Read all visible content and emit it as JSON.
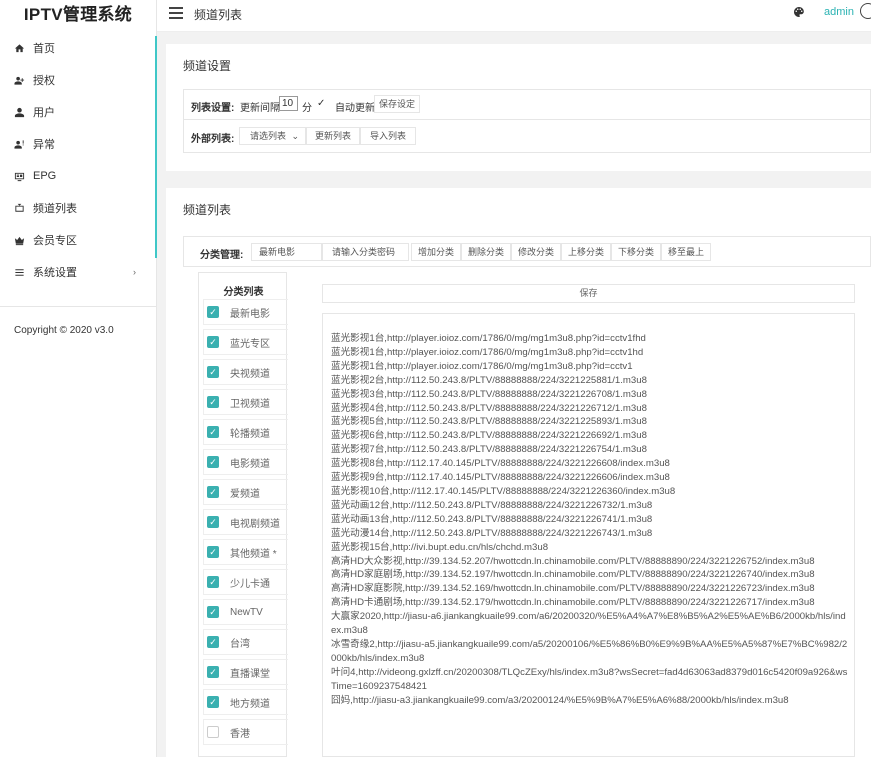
{
  "app": {
    "logo": "IPTV管理系统",
    "copyright": "Copyright © 2020 v3.0"
  },
  "sidebar": {
    "items": [
      {
        "label": "首页",
        "icon": "home-icon"
      },
      {
        "label": "授权",
        "icon": "user-plus-icon"
      },
      {
        "label": "用户",
        "icon": "user-icon"
      },
      {
        "label": "异常",
        "icon": "user-alert-icon"
      },
      {
        "label": "EPG",
        "icon": "tv-guide-icon"
      },
      {
        "label": "频道列表",
        "icon": "tv-icon"
      },
      {
        "label": "会员专区",
        "icon": "crown-icon"
      },
      {
        "label": "系统设置",
        "icon": "list-icon",
        "arrow": "›"
      }
    ]
  },
  "header": {
    "title": "频道列表",
    "user": "admin"
  },
  "settings": {
    "title": "频道设置",
    "list_settings_label": "列表设置:",
    "interval_label": "更新间隔",
    "interval_value": "10",
    "interval_unit": "分",
    "auto_update_check": "✓",
    "auto_update_label": "自动更新",
    "save_settings": "保存设定",
    "external_label": "外部列表:",
    "select_list": "请选列表",
    "update_list": "更新列表",
    "import_list": "导入列表"
  },
  "channels": {
    "title": "频道列表",
    "category_mgmt_label": "分类管理:",
    "category_name": "最新电影",
    "password_placeholder": "请输入分类密码",
    "buttons": [
      "增加分类",
      "删除分类",
      "修改分类",
      "上移分类",
      "下移分类",
      "移至最上"
    ],
    "category_list_title": "分类列表",
    "save": "保存",
    "categories": [
      {
        "label": "最新电影",
        "checked": true
      },
      {
        "label": "蓝光专区",
        "checked": true
      },
      {
        "label": "央视频道",
        "checked": true
      },
      {
        "label": "卫视频道",
        "checked": true
      },
      {
        "label": "轮播频道",
        "checked": true
      },
      {
        "label": "电影频道",
        "checked": true
      },
      {
        "label": "爱频道",
        "checked": true
      },
      {
        "label": "电视剧频道",
        "checked": true
      },
      {
        "label": "其他频道 *",
        "checked": true
      },
      {
        "label": "少儿卡通",
        "checked": true
      },
      {
        "label": "NewTV",
        "checked": true
      },
      {
        "label": "台湾",
        "checked": true
      },
      {
        "label": "直播课堂",
        "checked": true
      },
      {
        "label": "地方频道",
        "checked": true
      },
      {
        "label": "香港",
        "checked": false
      }
    ],
    "list_text": "蓝光影视1台,http://player.ioioz.com/1786/0/mg/mg1m3u8.php?id=cctv1fhd\n蓝光影视1台,http://player.ioioz.com/1786/0/mg/mg1m3u8.php?id=cctv1hd\n蓝光影视1台,http://player.ioioz.com/1786/0/mg/mg1m3u8.php?id=cctv1\n蓝光影视2台,http://112.50.243.8/PLTV/88888888/224/3221225881/1.m3u8\n蓝光影视3台,http://112.50.243.8/PLTV/88888888/224/3221226708/1.m3u8\n蓝光影视4台,http://112.50.243.8/PLTV/88888888/224/3221226712/1.m3u8\n蓝光影视5台,http://112.50.243.8/PLTV/88888888/224/3221225893/1.m3u8\n蓝光影视6台,http://112.50.243.8/PLTV/88888888/224/3221226692/1.m3u8\n蓝光影视7台,http://112.50.243.8/PLTV/88888888/224/3221226754/1.m3u8\n蓝光影视8台,http://112.17.40.145/PLTV/88888888/224/3221226608/index.m3u8\n蓝光影视9台,http://112.17.40.145/PLTV/88888888/224/3221226606/index.m3u8\n蓝光影视10台,http://112.17.40.145/PLTV/88888888/224/3221226360/index.m3u8\n蓝光动画12台,http://112.50.243.8/PLTV/88888888/224/3221226732/1.m3u8\n蓝光动画13台,http://112.50.243.8/PLTV/88888888/224/3221226741/1.m3u8\n蓝光动漫14台,http://112.50.243.8/PLTV/88888888/224/3221226743/1.m3u8\n蓝光影视15台,http://ivi.bupt.edu.cn/hls/chchd.m3u8\n高清HD大众影视,http://39.134.52.207/hwottcdn.ln.chinamobile.com/PLTV/88888890/224/3221226752/index.m3u8\n高清HD家庭剧场,http://39.134.52.197/hwottcdn.ln.chinamobile.com/PLTV/88888890/224/3221226740/index.m3u8\n高清HD家庭影院,http://39.134.52.169/hwottcdn.ln.chinamobile.com/PLTV/88888890/224/3221226723/index.m3u8\n高清HD卡通剧场,http://39.134.52.179/hwottcdn.ln.chinamobile.com/PLTV/88888890/224/3221226717/index.m3u8\n大赢家2020,http://jiasu-a6.jiankangkuaile99.com/a6/20200320/%E5%A4%A7%E8%B5%A2%E5%AE%B6/2000kb/hls/index.m3u8\n冰雪奇缘2,http://jiasu-a5.jiankangkuaile99.com/a5/20200106/%E5%86%B0%E9%9B%AA%E5%A5%87%E7%BC%982/2000kb/hls/index.m3u8\n叶问4,http://videong.gxlzff.cn/20200308/TLQcZExy/hls/index.m3u8?wsSecret=fad4d63063ad8379d016c5420f09a926&wsTime=1609237548421\n囧妈,http://jiasu-a3.jiankangkuaile99.com/a3/20200124/%E5%9B%A7%E5%A6%88/2000kb/hls/index.m3u8"
  },
  "colors": {
    "accent": "#3ab0b0",
    "admin_text": "#2bb3b3"
  }
}
